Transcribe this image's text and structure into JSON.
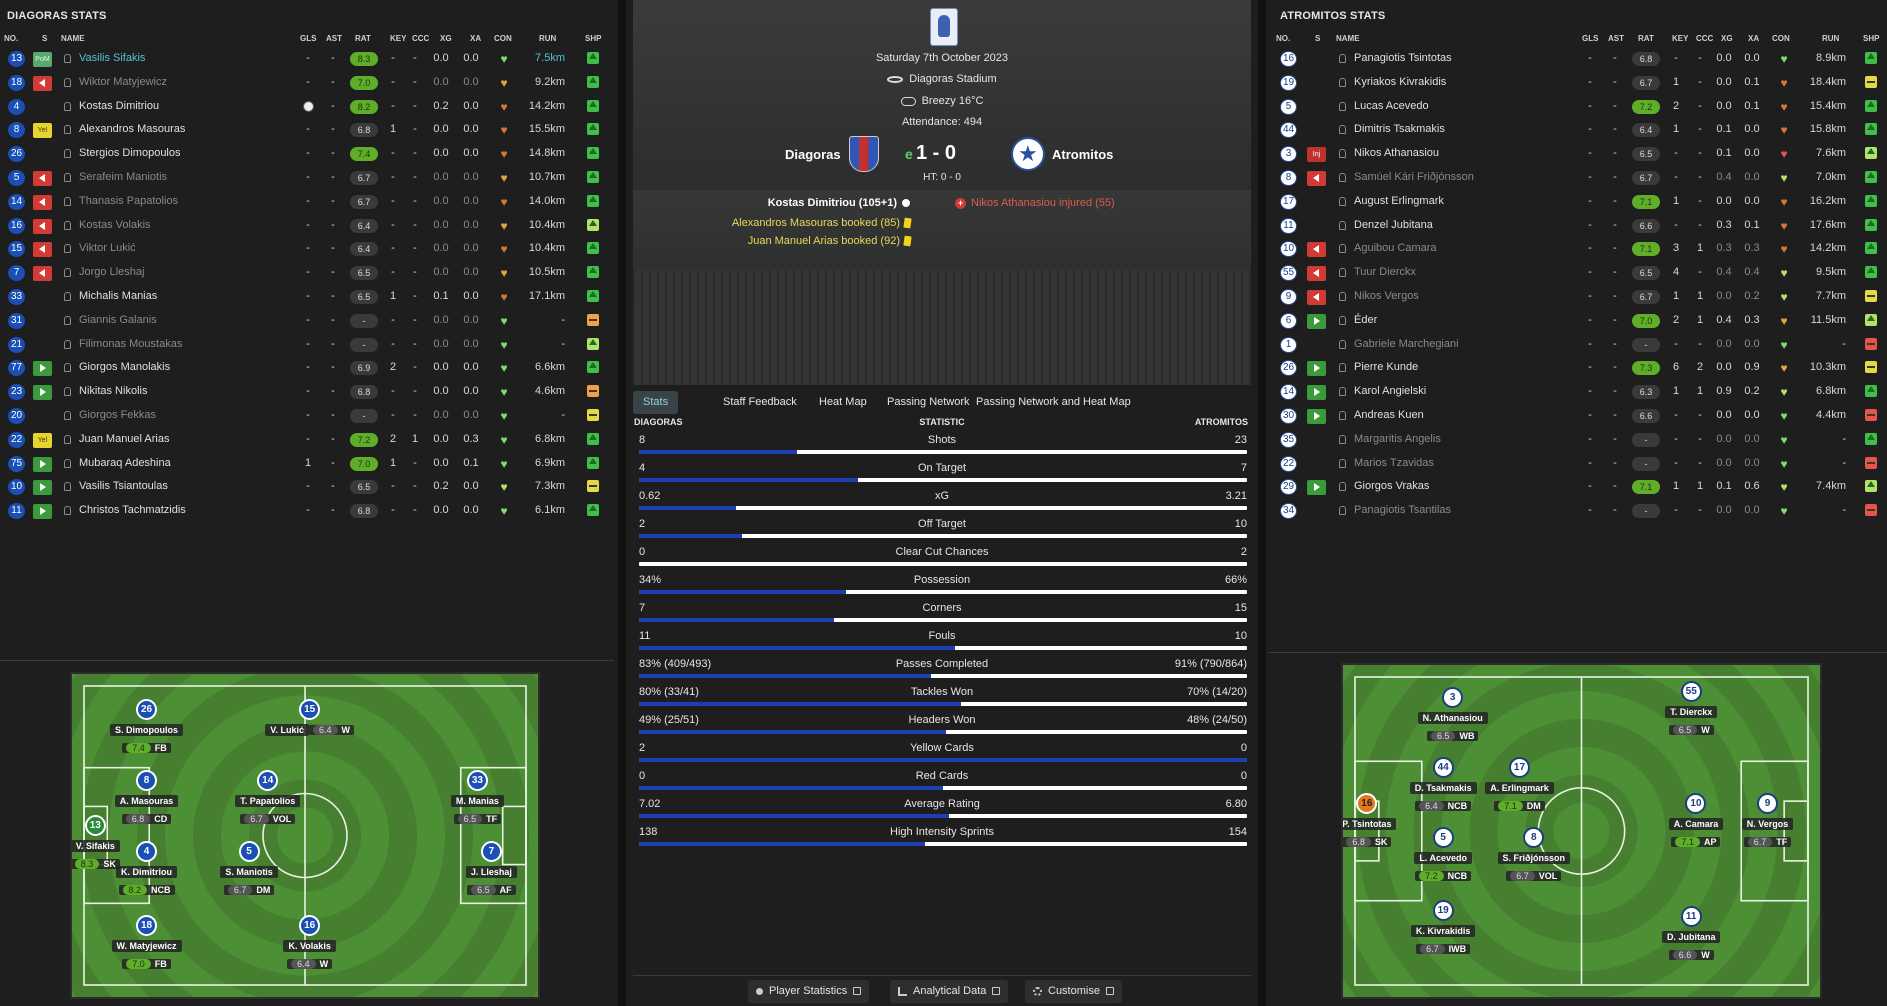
{
  "left": {
    "title": "DIAGORAS STATS",
    "headers": [
      "NO.",
      "S",
      "NAME",
      "GLS",
      "AST",
      "RAT",
      "KEY",
      "CCC",
      "XG",
      "XA",
      "CON",
      "RUN",
      "SHP"
    ],
    "players": [
      {
        "no": "13",
        "s": "PoM",
        "name": "Vasilis Sifakis",
        "gls": "-",
        "ast": "-",
        "rat": "8.3",
        "key": "-",
        "ccc": "-",
        "xg": "0.0",
        "xa": "0.0",
        "run": "7.5km"
      },
      {
        "no": "18",
        "s": "out",
        "name": "Wiktor Matyjewicz",
        "gls": "-",
        "ast": "-",
        "rat": "7.0",
        "key": "-",
        "ccc": "-",
        "xg": "0.0",
        "xa": "0.0",
        "run": "9.2km"
      },
      {
        "no": "4",
        "s": "",
        "name": "Kostas Dimitriou",
        "gls": "",
        "ast": "-",
        "rat": "8.2",
        "key": "-",
        "ccc": "-",
        "xg": "0.2",
        "xa": "0.0",
        "run": "14.2km"
      },
      {
        "no": "8",
        "s": "Yel",
        "name": "Alexandros Masouras",
        "gls": "-",
        "ast": "-",
        "rat": "6.8",
        "key": "1",
        "ccc": "-",
        "xg": "0.0",
        "xa": "0.0",
        "run": "15.5km"
      },
      {
        "no": "26",
        "s": "",
        "name": "Stergios Dimopoulos",
        "gls": "-",
        "ast": "-",
        "rat": "7.4",
        "key": "-",
        "ccc": "-",
        "xg": "0.0",
        "xa": "0.0",
        "run": "14.8km"
      },
      {
        "no": "5",
        "s": "out",
        "name": "Serafeim Maniotis",
        "gls": "-",
        "ast": "-",
        "rat": "6.7",
        "key": "-",
        "ccc": "-",
        "xg": "0.0",
        "xa": "0.0",
        "run": "10.7km"
      },
      {
        "no": "14",
        "s": "out",
        "name": "Thanasis Papatolios",
        "gls": "-",
        "ast": "-",
        "rat": "6.7",
        "key": "-",
        "ccc": "-",
        "xg": "0.0",
        "xa": "0.0",
        "run": "14.0km"
      },
      {
        "no": "16",
        "s": "out",
        "name": "Kostas Volakis",
        "gls": "-",
        "ast": "-",
        "rat": "6.4",
        "key": "-",
        "ccc": "-",
        "xg": "0.0",
        "xa": "0.0",
        "run": "10.4km"
      },
      {
        "no": "15",
        "s": "out",
        "name": "Viktor Lukić",
        "gls": "-",
        "ast": "-",
        "rat": "6.4",
        "key": "-",
        "ccc": "-",
        "xg": "0.0",
        "xa": "0.0",
        "run": "10.4km"
      },
      {
        "no": "7",
        "s": "out",
        "name": "Jorgo Lleshaj",
        "gls": "-",
        "ast": "-",
        "rat": "6.5",
        "key": "-",
        "ccc": "-",
        "xg": "0.0",
        "xa": "0.0",
        "run": "10.5km"
      },
      {
        "no": "33",
        "s": "",
        "name": "Michalis Manias",
        "gls": "-",
        "ast": "-",
        "rat": "6.5",
        "key": "1",
        "ccc": "-",
        "xg": "0.1",
        "xa": "0.0",
        "run": "17.1km"
      },
      {
        "no": "31",
        "s": "",
        "name": "Giannis Galanis",
        "gls": "-",
        "ast": "-",
        "rat": "-",
        "key": "-",
        "ccc": "-",
        "xg": "0.0",
        "xa": "0.0",
        "run": "-"
      },
      {
        "no": "21",
        "s": "",
        "name": "Filimonas Moustakas",
        "gls": "-",
        "ast": "-",
        "rat": "-",
        "key": "-",
        "ccc": "-",
        "xg": "0.0",
        "xa": "0.0",
        "run": "-"
      },
      {
        "no": "77",
        "s": "in",
        "name": "Giorgos Manolakis",
        "gls": "-",
        "ast": "-",
        "rat": "6.9",
        "key": "2",
        "ccc": "-",
        "xg": "0.0",
        "xa": "0.0",
        "run": "6.6km"
      },
      {
        "no": "23",
        "s": "in",
        "name": "Nikitas Nikolis",
        "gls": "-",
        "ast": "-",
        "rat": "6.8",
        "key": "-",
        "ccc": "-",
        "xg": "0.0",
        "xa": "0.0",
        "run": "4.6km"
      },
      {
        "no": "20",
        "s": "",
        "name": "Giorgos Fekkas",
        "gls": "-",
        "ast": "-",
        "rat": "-",
        "key": "-",
        "ccc": "-",
        "xg": "0.0",
        "xa": "0.0",
        "run": "-"
      },
      {
        "no": "22",
        "s": "Yel",
        "name": "Juan Manuel Arias",
        "gls": "-",
        "ast": "-",
        "rat": "7.2",
        "key": "2",
        "ccc": "1",
        "xg": "0.0",
        "xa": "0.3",
        "run": "6.8km"
      },
      {
        "no": "75",
        "s": "in",
        "name": "Mubaraq Adeshina",
        "gls": "1",
        "ast": "-",
        "rat": "7.0",
        "key": "1",
        "ccc": "-",
        "xg": "0.0",
        "xa": "0.1",
        "run": "6.9km"
      },
      {
        "no": "10",
        "s": "in",
        "name": "Vasilis Tsiantoulas",
        "gls": "-",
        "ast": "-",
        "rat": "6.5",
        "key": "-",
        "ccc": "-",
        "xg": "0.2",
        "xa": "0.0",
        "run": "7.3km"
      },
      {
        "no": "11",
        "s": "in",
        "name": "Christos Tachmatzidis",
        "gls": "-",
        "ast": "-",
        "rat": "6.8",
        "key": "-",
        "ccc": "-",
        "xg": "0.0",
        "xa": "0.0",
        "run": "6.1km"
      }
    ],
    "pitch": [
      {
        "no": "26",
        "name": "S. Dimopoulos",
        "rat": "7.4",
        "pos": "FB"
      },
      {
        "no": "15",
        "name": "V. Lukić",
        "rat": "6.4",
        "pos": "W"
      },
      {
        "no": "8",
        "name": "A. Masouras",
        "rat": "6.8",
        "pos": "CD"
      },
      {
        "no": "14",
        "name": "T. Papatolios",
        "rat": "6.7",
        "pos": "VOL"
      },
      {
        "no": "33",
        "name": "M. Manias",
        "rat": "6.5",
        "pos": "TF"
      },
      {
        "no": "13",
        "name": "V. Sifakis",
        "rat": "8.3",
        "pos": "SK"
      },
      {
        "no": "4",
        "name": "K. Dimitriou",
        "rat": "8.2",
        "pos": "NCB"
      },
      {
        "no": "5",
        "name": "S. Maniotis",
        "rat": "6.7",
        "pos": "DM"
      },
      {
        "no": "7",
        "name": "J. Lleshaj",
        "rat": "6.5",
        "pos": "AF"
      },
      {
        "no": "18",
        "name": "W. Matyjewicz",
        "rat": "7.0",
        "pos": "FB"
      },
      {
        "no": "16",
        "name": "K. Volakis",
        "rat": "6.4",
        "pos": "W"
      }
    ]
  },
  "right": {
    "title": "ATROMITOS STATS",
    "headers": [
      "NO.",
      "S",
      "NAME",
      "GLS",
      "AST",
      "RAT",
      "KEY",
      "CCC",
      "XG",
      "XA",
      "CON",
      "RUN",
      "SHP"
    ],
    "players": [
      {
        "no": "16",
        "s": "",
        "name": "Panagiotis Tsintotas",
        "gls": "-",
        "ast": "-",
        "rat": "6.8",
        "key": "-",
        "ccc": "-",
        "xg": "0.0",
        "xa": "0.0",
        "run": "8.9km"
      },
      {
        "no": "19",
        "s": "",
        "name": "Kyriakos Kivrakidis",
        "gls": "-",
        "ast": "-",
        "rat": "6.7",
        "key": "1",
        "ccc": "-",
        "xg": "0.0",
        "xa": "0.1",
        "run": "18.4km"
      },
      {
        "no": "5",
        "s": "",
        "name": "Lucas Acevedo",
        "gls": "-",
        "ast": "-",
        "rat": "7.2",
        "key": "2",
        "ccc": "-",
        "xg": "0.0",
        "xa": "0.1",
        "run": "15.4km"
      },
      {
        "no": "44",
        "s": "",
        "name": "Dimitris Tsakmakis",
        "gls": "-",
        "ast": "-",
        "rat": "6.4",
        "key": "1",
        "ccc": "-",
        "xg": "0.1",
        "xa": "0.0",
        "run": "15.8km"
      },
      {
        "no": "3",
        "s": "Inj",
        "name": "Nikos Athanasiou",
        "gls": "-",
        "ast": "-",
        "rat": "6.5",
        "key": "-",
        "ccc": "-",
        "xg": "0.1",
        "xa": "0.0",
        "run": "7.6km"
      },
      {
        "no": "8",
        "s": "out",
        "name": "Samúel Kári Friðjónsson",
        "gls": "-",
        "ast": "-",
        "rat": "6.7",
        "key": "-",
        "ccc": "-",
        "xg": "0.4",
        "xa": "0.0",
        "run": "7.0km"
      },
      {
        "no": "17",
        "s": "",
        "name": "August Erlingmark",
        "gls": "-",
        "ast": "-",
        "rat": "7.1",
        "key": "1",
        "ccc": "-",
        "xg": "0.0",
        "xa": "0.0",
        "run": "16.2km"
      },
      {
        "no": "11",
        "s": "",
        "name": "Denzel Jubitana",
        "gls": "-",
        "ast": "-",
        "rat": "6.6",
        "key": "-",
        "ccc": "-",
        "xg": "0.3",
        "xa": "0.1",
        "run": "17.6km"
      },
      {
        "no": "10",
        "s": "out",
        "name": "Aguibou Camara",
        "gls": "-",
        "ast": "-",
        "rat": "7.1",
        "key": "3",
        "ccc": "1",
        "xg": "0.3",
        "xa": "0.3",
        "run": "14.2km"
      },
      {
        "no": "55",
        "s": "out",
        "name": "Tuur Dierckx",
        "gls": "-",
        "ast": "-",
        "rat": "6.5",
        "key": "4",
        "ccc": "-",
        "xg": "0.4",
        "xa": "0.4",
        "run": "9.5km"
      },
      {
        "no": "9",
        "s": "out",
        "name": "Nikos Vergos",
        "gls": "-",
        "ast": "-",
        "rat": "6.7",
        "key": "1",
        "ccc": "1",
        "xg": "0.0",
        "xa": "0.2",
        "run": "7.7km"
      },
      {
        "no": "6",
        "s": "in",
        "name": "Éder",
        "gls": "-",
        "ast": "-",
        "rat": "7.0",
        "key": "2",
        "ccc": "1",
        "xg": "0.4",
        "xa": "0.3",
        "run": "11.5km"
      },
      {
        "no": "1",
        "s": "",
        "name": "Gabriele Marchegiani",
        "gls": "-",
        "ast": "-",
        "rat": "-",
        "key": "-",
        "ccc": "-",
        "xg": "0.0",
        "xa": "0.0",
        "run": "-"
      },
      {
        "no": "26",
        "s": "in",
        "name": "Pierre Kunde",
        "gls": "-",
        "ast": "-",
        "rat": "7.3",
        "key": "6",
        "ccc": "2",
        "xg": "0.0",
        "xa": "0.9",
        "run": "10.3km"
      },
      {
        "no": "14",
        "s": "in",
        "name": "Karol Angielski",
        "gls": "-",
        "ast": "-",
        "rat": "6.3",
        "key": "1",
        "ccc": "1",
        "xg": "0.9",
        "xa": "0.2",
        "run": "6.8km"
      },
      {
        "no": "30",
        "s": "in",
        "name": "Andreas Kuen",
        "gls": "-",
        "ast": "-",
        "rat": "6.6",
        "key": "-",
        "ccc": "-",
        "xg": "0.0",
        "xa": "0.0",
        "run": "4.4km"
      },
      {
        "no": "35",
        "s": "",
        "name": "Margaritis Angelis",
        "gls": "-",
        "ast": "-",
        "rat": "-",
        "key": "-",
        "ccc": "-",
        "xg": "0.0",
        "xa": "0.0",
        "run": "-"
      },
      {
        "no": "22",
        "s": "",
        "name": "Marios Tzavidas",
        "gls": "-",
        "ast": "-",
        "rat": "-",
        "key": "-",
        "ccc": "-",
        "xg": "0.0",
        "xa": "0.0",
        "run": "-"
      },
      {
        "no": "29",
        "s": "in",
        "name": "Giorgos Vrakas",
        "gls": "-",
        "ast": "-",
        "rat": "7.1",
        "key": "1",
        "ccc": "1",
        "xg": "0.1",
        "xa": "0.6",
        "run": "7.4km"
      },
      {
        "no": "34",
        "s": "",
        "name": "Panagiotis Tsantilas",
        "gls": "-",
        "ast": "-",
        "rat": "-",
        "key": "-",
        "ccc": "-",
        "xg": "0.0",
        "xa": "0.0",
        "run": "-"
      }
    ],
    "pitch": [
      {
        "no": "3",
        "name": "N. Athanasiou",
        "rat": "6.5",
        "pos": "WB"
      },
      {
        "no": "55",
        "name": "T. Dierckx",
        "rat": "6.5",
        "pos": "W"
      },
      {
        "no": "44",
        "name": "D. Tsakmakis",
        "rat": "6.4",
        "pos": "NCB"
      },
      {
        "no": "17",
        "name": "A. Erlingmark",
        "rat": "7.1",
        "pos": "DM"
      },
      {
        "no": "16",
        "name": "P. Tsintotas",
        "rat": "6.8",
        "pos": "SK"
      },
      {
        "no": "10",
        "name": "A. Camara",
        "rat": "7.1",
        "pos": "AP"
      },
      {
        "no": "9",
        "name": "N. Vergos",
        "rat": "6.7",
        "pos": "TF"
      },
      {
        "no": "5",
        "name": "L. Acevedo",
        "rat": "7.2",
        "pos": "NCB"
      },
      {
        "no": "8",
        "name": "S. Friðjónsson",
        "rat": "6.7",
        "pos": "VOL"
      },
      {
        "no": "19",
        "name": "K. Kivrakidis",
        "rat": "6.7",
        "pos": "IWB"
      },
      {
        "no": "11",
        "name": "D. Jubitana",
        "rat": "6.6",
        "pos": "W"
      }
    ]
  },
  "match": {
    "date": "Saturday 7th October 2023",
    "stadium": "Diagoras Stadium",
    "weather": "Breezy 16°C",
    "attendance": "Attendance:  494",
    "home": "Diagoras",
    "away": "Atromitos",
    "score_prefix": "e",
    "score": "1 - 0",
    "ht": "HT: 0 - 0",
    "events_home": [
      "Kostas Dimitriou (105+1)",
      "Alexandros Masouras booked (85)",
      "Juan Manuel Arias booked (92)"
    ],
    "events_away": [
      "Nikos Athanasiou injured (55)"
    ]
  },
  "tabs": [
    "Stats",
    "Staff Feedback",
    "Heat Map",
    "Passing Network",
    "Passing Network and Heat Map"
  ],
  "stats_header": {
    "home": "DIAGORAS",
    "mid": "STATISTIC",
    "away": "ATROMITOS"
  },
  "stats": [
    {
      "l": "8",
      "name": "Shots",
      "r": "23",
      "share": 0.26
    },
    {
      "l": "4",
      "name": "On Target",
      "r": "7",
      "share": 0.36
    },
    {
      "l": "0.62",
      "name": "xG",
      "r": "3.21",
      "share": 0.16
    },
    {
      "l": "2",
      "name": "Off Target",
      "r": "10",
      "share": 0.17
    },
    {
      "l": "0",
      "name": "Clear Cut Chances",
      "r": "2",
      "share": 0.0
    },
    {
      "l": "34%",
      "name": "Possession",
      "r": "66%",
      "share": 0.34
    },
    {
      "l": "7",
      "name": "Corners",
      "r": "15",
      "share": 0.32
    },
    {
      "l": "11",
      "name": "Fouls",
      "r": "10",
      "share": 0.52
    },
    {
      "l": "83% (409/493)",
      "name": "Passes Completed",
      "r": "91% (790/864)",
      "share": 0.48
    },
    {
      "l": "80% (33/41)",
      "name": "Tackles Won",
      "r": "70% (14/20)",
      "share": 0.53
    },
    {
      "l": "49% (25/51)",
      "name": "Headers Won",
      "r": "48% (24/50)",
      "share": 0.505
    },
    {
      "l": "2",
      "name": "Yellow Cards",
      "r": "0",
      "share": 1.0
    },
    {
      "l": "0",
      "name": "Red Cards",
      "r": "0",
      "share": 0.5
    },
    {
      "l": "7.02",
      "name": "Average Rating",
      "r": "6.80",
      "share": 0.51
    },
    {
      "l": "138",
      "name": "High Intensity Sprints",
      "r": "154",
      "share": 0.47
    }
  ],
  "buttons": [
    "Player Statistics",
    "Analytical Data",
    "Customise"
  ]
}
